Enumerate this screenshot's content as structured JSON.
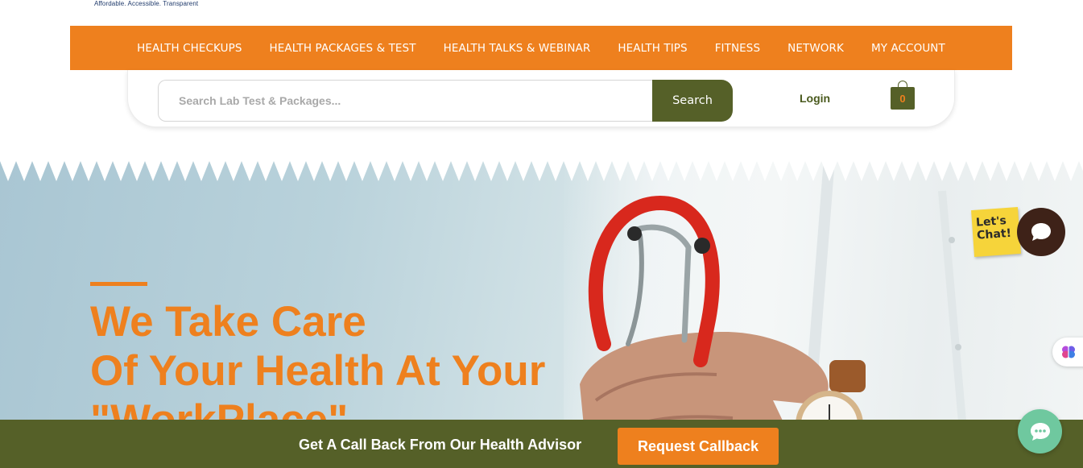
{
  "logo": {
    "tagline": "Affordable. Accessible. Transparent"
  },
  "nav": {
    "items": [
      {
        "label": "HEALTH CHECKUPS"
      },
      {
        "label": "HEALTH PACKAGES & TEST"
      },
      {
        "label": "HEALTH TALKS & WEBINAR"
      },
      {
        "label": "HEALTH TIPS"
      },
      {
        "label": "FITNESS"
      },
      {
        "label": "NETWORK"
      },
      {
        "label": "MY ACCOUNT"
      }
    ]
  },
  "search": {
    "placeholder": "Search Lab Test & Packages...",
    "value": "",
    "button_label": "Search"
  },
  "header": {
    "login_label": "Login",
    "cart_count": "0",
    "cart_icon": "shopping-bag-icon"
  },
  "hero": {
    "title_lines": [
      "We Take Care",
      "Of Your Health At Your",
      "\"WorkPlace\""
    ]
  },
  "chat": {
    "note_line1": "Let's",
    "note_line2": "Chat!",
    "icon": "chat-bubble-icon"
  },
  "callback": {
    "text": "Get A Call Back From Our Health Advisor",
    "button_label": "Request Callback"
  },
  "colors": {
    "brand_orange": "#ee801e",
    "brand_olive": "#556028",
    "chat_brown": "#3e2218",
    "message_green": "#6fc89f"
  }
}
